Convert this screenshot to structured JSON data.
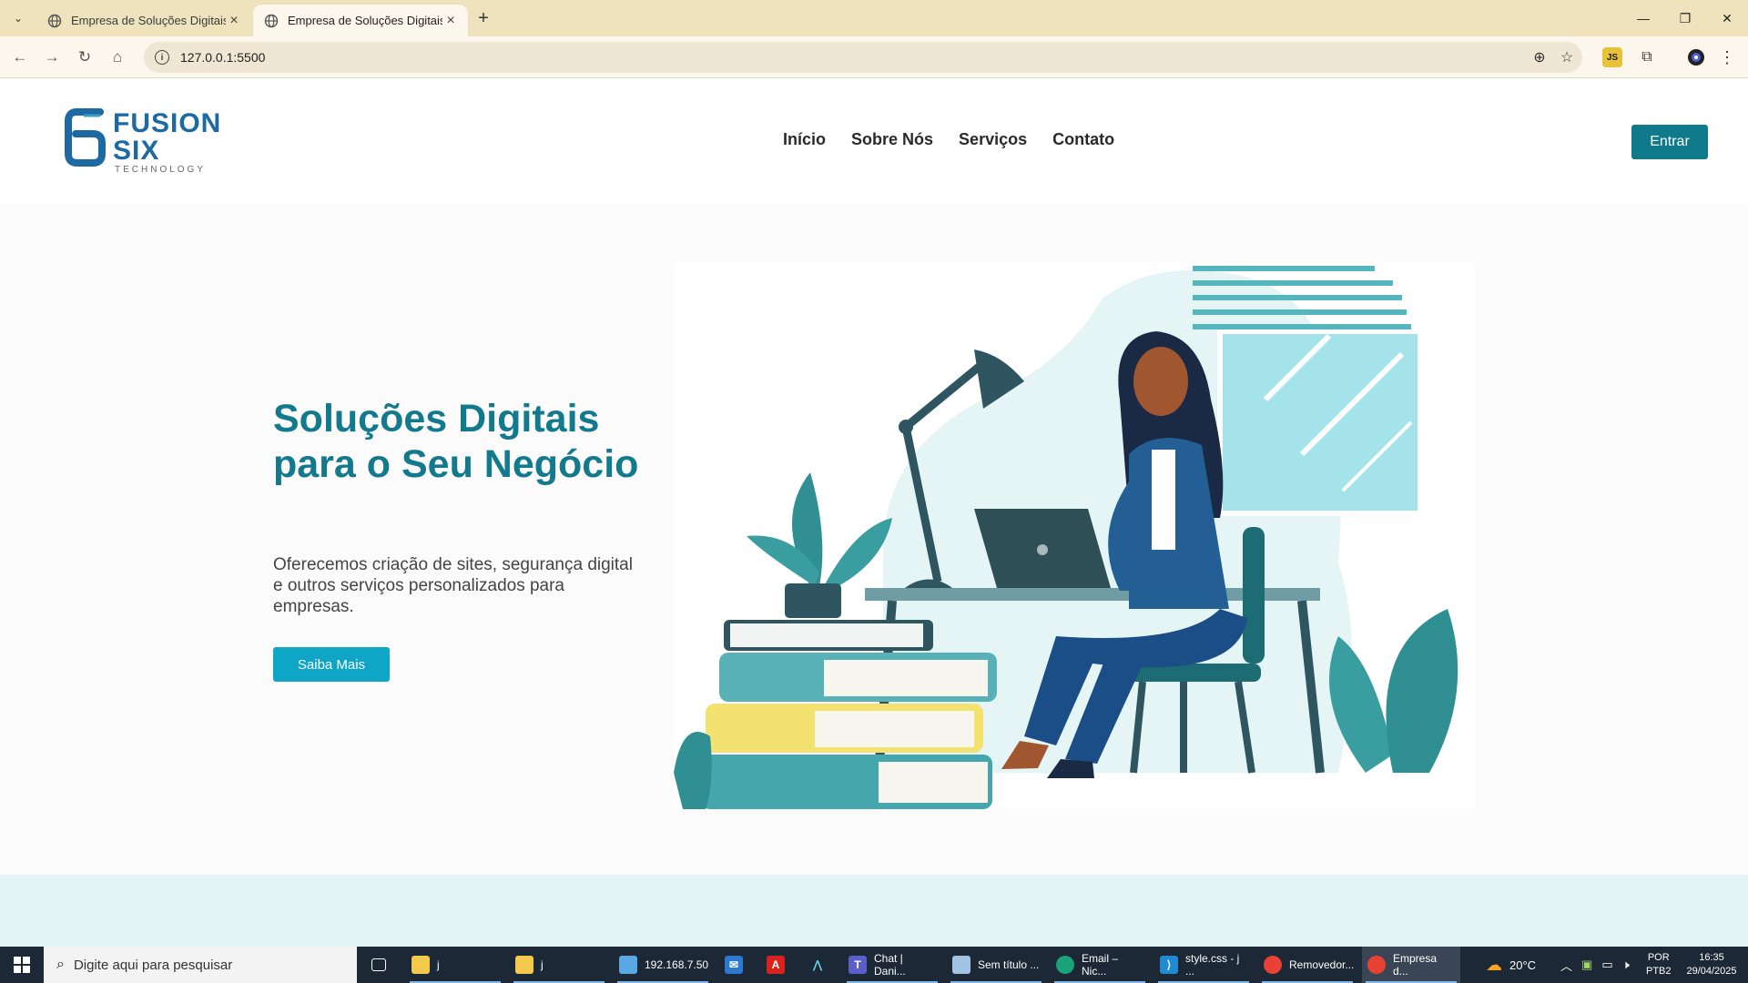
{
  "browser": {
    "tabs": [
      {
        "title": "Empresa de Soluções Digitais",
        "active": false
      },
      {
        "title": "Empresa de Soluções Digitais",
        "active": true
      }
    ],
    "url": "127.0.0.1:5500"
  },
  "site": {
    "logo": {
      "line1": "FUSION",
      "line2": "SIX",
      "line3": "TECHNOLOGY",
      "mark": "6"
    },
    "nav": [
      "Início",
      "Sobre Nós",
      "Serviços",
      "Contato"
    ],
    "login_label": "Entrar",
    "hero": {
      "title": "Soluções Digitais para o Seu Negócio",
      "text": "Oferecemos criação de sites, segurança digital e outros serviços personalizados para empresas.",
      "cta_label": "Saiba Mais"
    },
    "colors": {
      "brand": "#0e7a8c",
      "title": "#137a8e",
      "cta": "#0ea5c7",
      "logo": "#1d6aa3"
    }
  },
  "taskbar": {
    "search_placeholder": "Digite aqui para pesquisar",
    "items": [
      {
        "label": "j",
        "icon": "folder-icon"
      },
      {
        "label": "j",
        "icon": "folder-icon"
      },
      {
        "label": "192.168.7.50",
        "icon": "remote-desktop-icon"
      },
      {
        "label": "",
        "icon": "mail-icon"
      },
      {
        "label": "",
        "icon": "acrobat-icon"
      },
      {
        "label": "",
        "icon": "app-icon"
      },
      {
        "label": "Chat | Dani...",
        "icon": "teams-icon"
      },
      {
        "label": "Sem título ...",
        "icon": "notepad-icon"
      },
      {
        "label": "Email – Nic...",
        "icon": "edge-icon"
      },
      {
        "label": "style.css - j ...",
        "icon": "vscode-icon"
      },
      {
        "label": "Removedor...",
        "icon": "chrome-icon"
      },
      {
        "label": "Empresa d...",
        "icon": "chrome-icon"
      }
    ],
    "weather": "20°C",
    "lang_line1": "POR",
    "lang_line2": "PTB2",
    "time": "16:35",
    "date": "29/04/2025"
  }
}
